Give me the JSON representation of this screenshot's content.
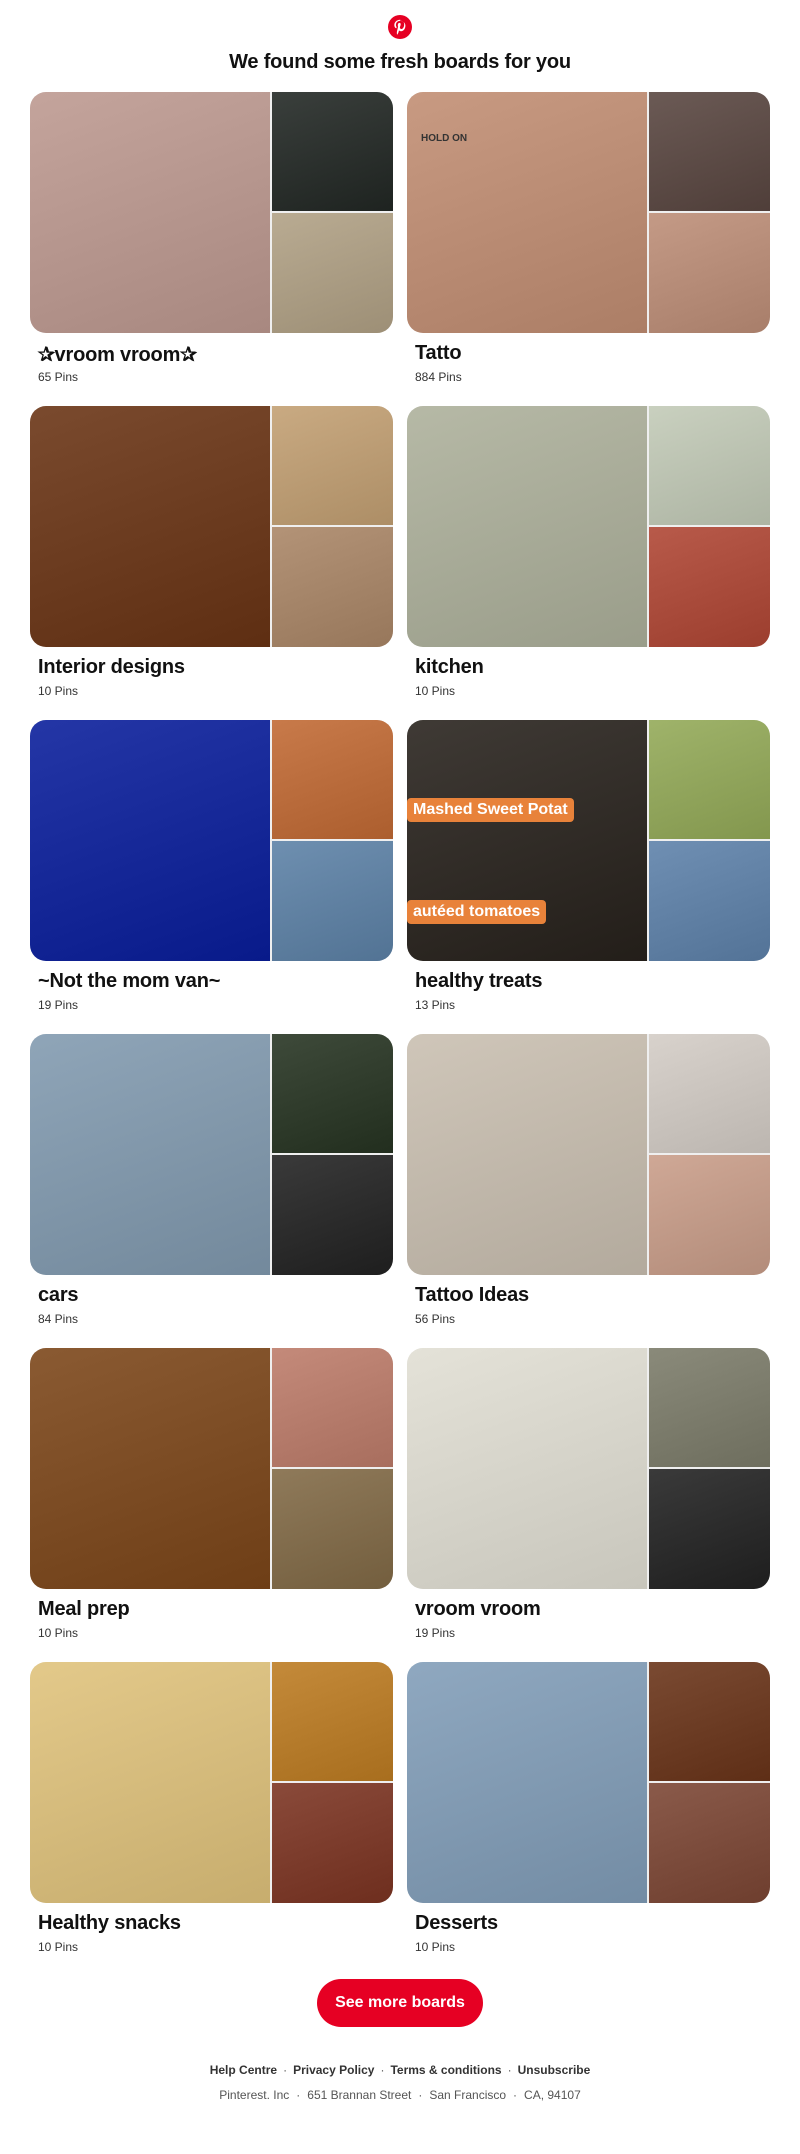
{
  "header": {
    "logo_icon": "pinterest-logo-icon",
    "brand_color": "#e60023",
    "headline": "We found some fresh boards for you"
  },
  "boards": [
    {
      "name": "✰vroom vroom✰",
      "pins": "65 Pins",
      "colors": [
        "#c4a49c",
        "#3a3f3c",
        "#b9ab92"
      ]
    },
    {
      "name": "Tatto",
      "pins": "884 Pins",
      "colors": [
        "#c89a82",
        "#6b5a55",
        "#c49a86"
      ]
    },
    {
      "name": "Interior designs",
      "pins": "10 Pins",
      "colors": [
        "#7a4a2e",
        "#c9aa82",
        "#b39377"
      ]
    },
    {
      "name": "kitchen",
      "pins": "10 Pins",
      "colors": [
        "#b6b9a6",
        "#c9d0bf",
        "#b85a4a"
      ]
    },
    {
      "name": "~Not the mom van~",
      "pins": "19 Pins",
      "colors": [
        "#2436a6",
        "#c87a4a",
        "#6e8fb0"
      ]
    },
    {
      "name": "healthy treats",
      "pins": "13 Pins",
      "colors": [
        "#3f3a35",
        "#9fb36a",
        "#6f8fb3"
      ]
    },
    {
      "name": "cars",
      "pins": "84 Pins",
      "colors": [
        "#8fa5b8",
        "#3e4a3a",
        "#3a3a3a"
      ]
    },
    {
      "name": "Tattoo Ideas",
      "pins": "56 Pins",
      "colors": [
        "#cfc6b9",
        "#d8d2cc",
        "#cfa896"
      ]
    },
    {
      "name": "Meal prep",
      "pins": "10 Pins",
      "colors": [
        "#8a5a32",
        "#c48a7a",
        "#8f7a5a"
      ]
    },
    {
      "name": "vroom vroom",
      "pins": "19 Pins",
      "colors": [
        "#e4e2d8",
        "#8a8a7a",
        "#3a3a3a"
      ]
    },
    {
      "name": "Healthy snacks",
      "pins": "10 Pins",
      "colors": [
        "#e3c98a",
        "#c48a3a",
        "#8a4a3a"
      ]
    },
    {
      "name": "Desserts",
      "pins": "10 Pins",
      "colors": [
        "#8fa8c0",
        "#7a4a32",
        "#8a5a4a"
      ]
    }
  ],
  "overlays": {
    "healthy_treats_text_1": "Mashed Sweet Potat",
    "healthy_treats_text_2": "autéed tomatoes",
    "tattoo_text": "HOLD ON"
  },
  "cta": {
    "label": "See more boards"
  },
  "footer": {
    "links": [
      "Help Centre",
      "Privacy Policy",
      "Terms & conditions",
      "Unsubscribe"
    ],
    "company": "Pinterest. Inc",
    "street": "651 Brannan Street",
    "city": "San Francisco",
    "state_zip": "CA, 94107"
  }
}
